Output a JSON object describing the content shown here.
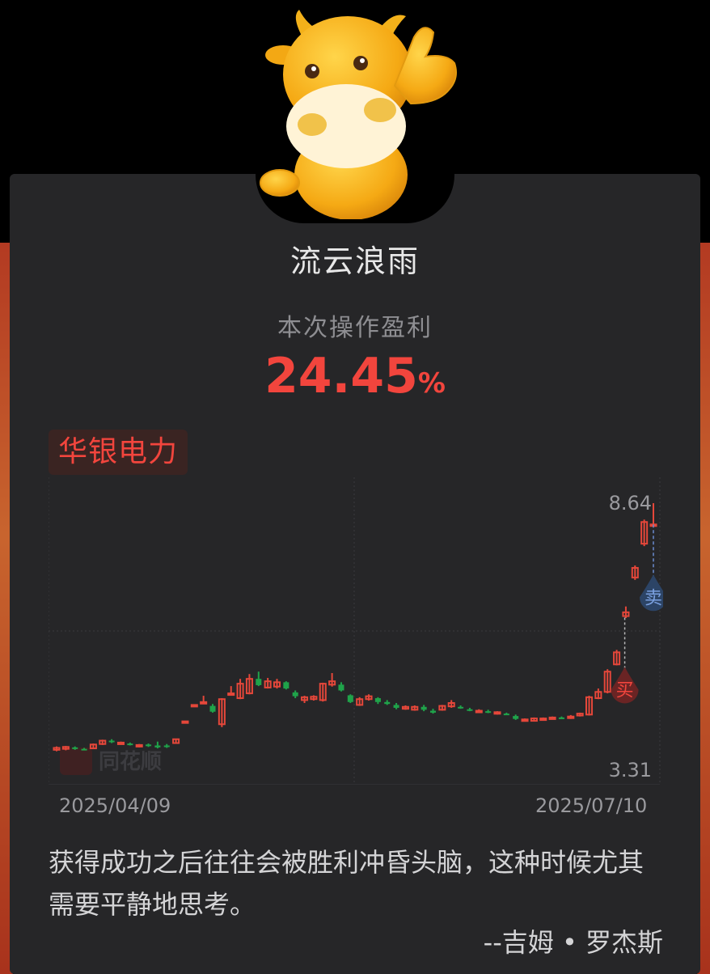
{
  "card": {
    "user_name": "流云浪雨",
    "profit_label": "本次操作盈利",
    "profit_value": "24.45",
    "profit_unit": "%"
  },
  "stock": {
    "name": "华银电力"
  },
  "watermark": "同花顺",
  "chart_data": {
    "type": "candlestick",
    "x_start_label": "2025/04/09",
    "x_end_label": "2025/07/10",
    "y_max_label": "8.64",
    "y_min_label": "3.31",
    "ylim": [
      3.31,
      8.64
    ],
    "grid": true,
    "up_color": "#e5473a",
    "down_color": "#1fa34a",
    "buy_marker": "买",
    "sell_marker": "卖",
    "candles": [
      [
        3.53,
        3.57,
        3.5,
        3.6
      ],
      [
        3.55,
        3.59,
        3.52,
        3.61
      ],
      [
        3.58,
        3.55,
        3.53,
        3.6
      ],
      [
        3.55,
        3.54,
        3.52,
        3.57
      ],
      [
        3.56,
        3.64,
        3.55,
        3.66
      ],
      [
        3.65,
        3.72,
        3.63,
        3.74
      ],
      [
        3.72,
        3.7,
        3.67,
        3.75
      ],
      [
        3.66,
        3.68,
        3.64,
        3.7
      ],
      [
        3.66,
        3.64,
        3.62,
        3.68
      ],
      [
        3.6,
        3.63,
        3.58,
        3.65
      ],
      [
        3.64,
        3.62,
        3.59,
        3.66
      ],
      [
        3.62,
        3.58,
        3.56,
        3.7
      ],
      [
        3.62,
        3.6,
        3.57,
        3.65
      ],
      [
        3.67,
        3.75,
        3.66,
        3.76
      ],
      [
        4.1,
        4.12,
        4.09,
        4.13
      ],
      [
        4.44,
        4.46,
        4.43,
        4.47
      ],
      [
        4.5,
        4.52,
        4.48,
        4.65
      ],
      [
        4.44,
        4.32,
        4.3,
        4.48
      ],
      [
        4.06,
        4.58,
        4.0,
        4.6
      ],
      [
        4.68,
        4.7,
        4.66,
        4.85
      ],
      [
        4.6,
        4.9,
        4.58,
        5.0
      ],
      [
        4.7,
        5.0,
        4.68,
        5.1
      ],
      [
        5.0,
        4.87,
        4.85,
        5.15
      ],
      [
        4.82,
        4.95,
        4.8,
        5.02
      ],
      [
        4.84,
        4.93,
        4.8,
        5.0
      ],
      [
        4.93,
        4.8,
        4.78,
        4.95
      ],
      [
        4.72,
        4.64,
        4.6,
        4.76
      ],
      [
        4.56,
        4.62,
        4.5,
        4.65
      ],
      [
        4.58,
        4.63,
        4.55,
        4.66
      ],
      [
        4.56,
        4.9,
        4.53,
        4.92
      ],
      [
        4.88,
        4.95,
        4.84,
        5.12
      ],
      [
        4.88,
        4.76,
        4.74,
        4.93
      ],
      [
        4.66,
        4.52,
        4.5,
        4.68
      ],
      [
        4.46,
        4.58,
        4.44,
        4.62
      ],
      [
        4.58,
        4.64,
        4.55,
        4.68
      ],
      [
        4.6,
        4.52,
        4.48,
        4.62
      ],
      [
        4.52,
        4.48,
        4.46,
        4.56
      ],
      [
        4.46,
        4.4,
        4.37,
        4.5
      ],
      [
        4.38,
        4.42,
        4.36,
        4.45
      ],
      [
        4.36,
        4.42,
        4.34,
        4.45
      ],
      [
        4.42,
        4.36,
        4.33,
        4.46
      ],
      [
        4.34,
        4.3,
        4.28,
        4.38
      ],
      [
        4.36,
        4.44,
        4.34,
        4.46
      ],
      [
        4.43,
        4.5,
        4.4,
        4.56
      ],
      [
        4.42,
        4.4,
        4.38,
        4.45
      ],
      [
        4.37,
        4.35,
        4.33,
        4.4
      ],
      [
        4.32,
        4.34,
        4.3,
        4.37
      ],
      [
        4.33,
        4.31,
        4.29,
        4.36
      ],
      [
        4.28,
        4.31,
        4.26,
        4.33
      ],
      [
        4.28,
        4.27,
        4.25,
        4.3
      ],
      [
        4.23,
        4.17,
        4.15,
        4.26
      ],
      [
        4.14,
        4.16,
        4.12,
        4.18
      ],
      [
        4.13,
        4.18,
        4.12,
        4.2
      ],
      [
        4.16,
        4.18,
        4.14,
        4.2
      ],
      [
        4.18,
        4.2,
        4.16,
        4.22
      ],
      [
        4.2,
        4.19,
        4.17,
        4.22
      ],
      [
        4.19,
        4.22,
        4.17,
        4.25
      ],
      [
        4.24,
        4.28,
        4.22,
        4.3
      ],
      [
        4.26,
        4.62,
        4.24,
        4.65
      ],
      [
        4.6,
        4.73,
        4.58,
        4.8
      ],
      [
        4.73,
        5.15,
        4.7,
        5.2
      ],
      [
        5.3,
        5.55,
        5.28,
        5.6
      ],
      [
        6.3,
        6.38,
        6.26,
        6.5
      ],
      [
        7.1,
        7.3,
        7.05,
        7.35
      ],
      [
        7.8,
        8.25,
        7.75,
        8.3
      ],
      [
        8.2,
        8.2,
        8.18,
        8.64
      ]
    ],
    "buy_index": 61,
    "sell_index": 65
  },
  "quote": {
    "text": "获得成功之后往往会被胜利冲昏头脑，这种时候尤其需要平静地思考。",
    "author": "--吉姆 • 罗杰斯"
  }
}
